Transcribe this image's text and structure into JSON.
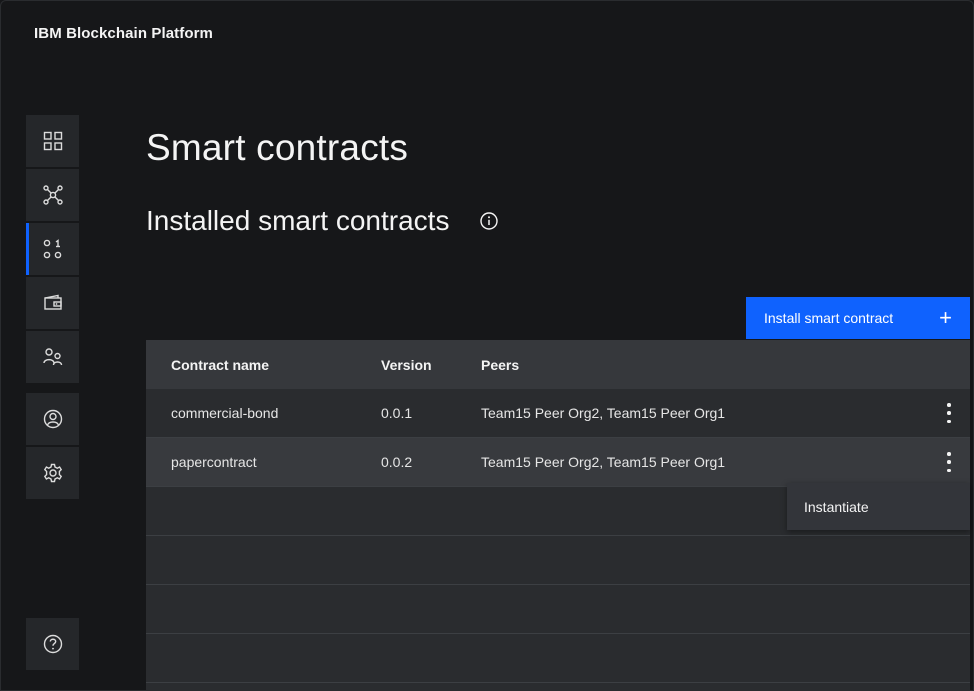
{
  "app": {
    "brand": "IBM Blockchain Platform"
  },
  "sidenav": {
    "items": [
      {
        "icon": "dashboard-grid-icon"
      },
      {
        "icon": "network-nodes-icon"
      },
      {
        "icon": "smart-contracts-icon",
        "active": true
      },
      {
        "icon": "wallet-icon"
      },
      {
        "icon": "users-icon"
      },
      {
        "icon": "user-profile-icon"
      },
      {
        "icon": "settings-gear-icon"
      },
      {
        "icon": "help-icon"
      }
    ]
  },
  "main": {
    "page_title": "Smart contracts",
    "section_title": "Installed smart contracts",
    "install_button": {
      "label": "Install smart contract",
      "icon": "plus-icon"
    },
    "table": {
      "columns": [
        "Contract name",
        "Version",
        "Peers"
      ],
      "rows": [
        {
          "name": "commercial-bond",
          "version": "0.0.1",
          "peers": "Team15 Peer Org2, Team15 Peer Org1"
        },
        {
          "name": "papercontract",
          "version": "0.0.2",
          "peers": "Team15 Peer Org2, Team15 Peer Org1"
        }
      ]
    },
    "overflow_menu": {
      "items": [
        "Instantiate"
      ]
    }
  },
  "colors": {
    "background": "#161719",
    "accent": "#0f62fe",
    "table_header": "#36383c",
    "table_body": "#2a2c2f"
  }
}
